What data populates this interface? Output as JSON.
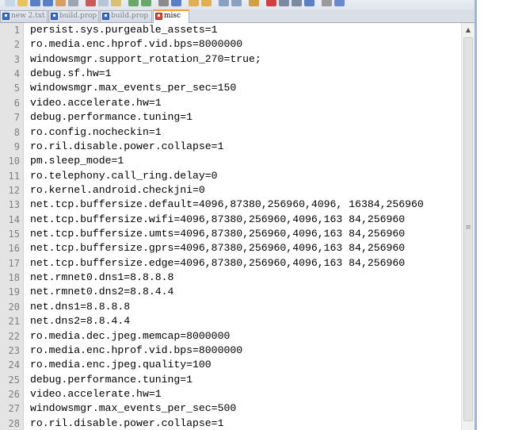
{
  "tabs": [
    {
      "label": "new  2.txt",
      "state": "saved"
    },
    {
      "label": "build.prop",
      "state": "saved"
    },
    {
      "label": "build.prop",
      "state": "saved"
    },
    {
      "label": "misc",
      "state": "unsaved",
      "active": true
    }
  ],
  "editor": {
    "lines": [
      {
        "n": "1",
        "text": "persist.sys.purgeable_assets=1"
      },
      {
        "n": "2",
        "text": "ro.media.enc.hprof.vid.bps=8000000"
      },
      {
        "n": "3",
        "text": "windowsmgr.support_rotation_270=true;"
      },
      {
        "n": "4",
        "text": "debug.sf.hw=1"
      },
      {
        "n": "5",
        "text": "windowsmgr.max_events_per_sec=150"
      },
      {
        "n": "6",
        "text": "video.accelerate.hw=1"
      },
      {
        "n": "7",
        "text": "debug.performance.tuning=1"
      },
      {
        "n": "8",
        "text": "ro.config.nocheckin=1"
      },
      {
        "n": "9",
        "text": "ro.ril.disable.power.collapse=1"
      },
      {
        "n": "10",
        "text": "pm.sleep_mode=1"
      },
      {
        "n": "11",
        "text": "ro.telephony.call_ring.delay=0"
      },
      {
        "n": "12",
        "text": "ro.kernel.android.checkjni=0"
      },
      {
        "n": "13",
        "text": "net.tcp.buffersize.default=4096,87380,256960,4096, 16384,256960"
      },
      {
        "n": "14",
        "text": "net.tcp.buffersize.wifi=4096,87380,256960,4096,163 84,256960"
      },
      {
        "n": "15",
        "text": "net.tcp.buffersize.umts=4096,87380,256960,4096,163 84,256960"
      },
      {
        "n": "16",
        "text": "net.tcp.buffersize.gprs=4096,87380,256960,4096,163 84,256960"
      },
      {
        "n": "17",
        "text": "net.tcp.buffersize.edge=4096,87380,256960,4096,163 84,256960"
      },
      {
        "n": "18",
        "text": "net.rmnet0.dns1=8.8.8.8"
      },
      {
        "n": "19",
        "text": "net.rmnet0.dns2=8.8.4.4"
      },
      {
        "n": "20",
        "text": "net.dns1=8.8.8.8"
      },
      {
        "n": "21",
        "text": "net.dns2=8.8.4.4"
      },
      {
        "n": "22",
        "text": "ro.media.dec.jpeg.memcap=8000000"
      },
      {
        "n": "23",
        "text": "ro.media.enc.hprof.vid.bps=8000000"
      },
      {
        "n": "24",
        "text": "ro.media.enc.jpeg.quality=100"
      },
      {
        "n": "25",
        "text": "debug.performance.tuning=1"
      },
      {
        "n": "26",
        "text": "video.accelerate.hw=1"
      },
      {
        "n": "27",
        "text": "windowsmgr.max_events_per_sec=500"
      },
      {
        "n": "28",
        "text": "ro.ril.disable.power.collapse=1"
      }
    ]
  },
  "scrollbar": {
    "up_arrow": "▲",
    "grip": "≡"
  },
  "colors": {
    "active_tab_accent": "#f2a13a",
    "saved_icon": "#3b6fc9",
    "unsaved_icon": "#d94a3d",
    "gutter": "#e4e4e4"
  }
}
